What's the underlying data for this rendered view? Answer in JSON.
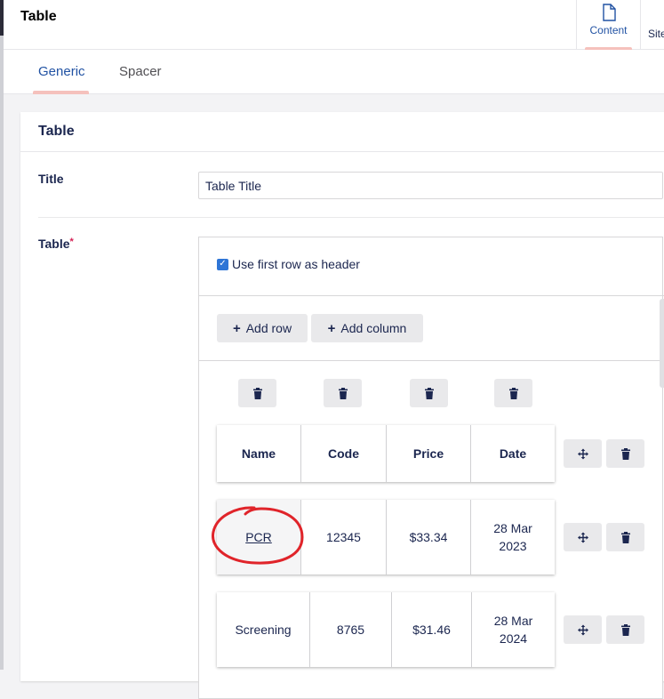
{
  "header": {
    "title": "Table"
  },
  "app_tabs": [
    {
      "label": "Content",
      "icon": "document-icon",
      "active": true
    },
    {
      "label": "Site"
    }
  ],
  "subtabs": [
    {
      "label": "Generic",
      "active": true
    },
    {
      "label": "Spacer",
      "active": false
    }
  ],
  "panel": {
    "title": "Table",
    "fields": {
      "title_label": "Title",
      "title_value": "Table Title",
      "table_label": "Table",
      "required_mark": "*"
    }
  },
  "table_editor": {
    "header_option": {
      "label": "Use first row as header",
      "checked": true
    },
    "add_row_label": "Add row",
    "add_column_label": "Add column",
    "rows": [
      {
        "cells": [
          "Name",
          "Code",
          "Price",
          "Date"
        ],
        "is_header": true
      },
      {
        "cells": [
          "PCR",
          "12345",
          "$33.34",
          "28 Mar 2023"
        ]
      },
      {
        "cells": [
          "Screening",
          "8765",
          "$31.46",
          "28 Mar 2024"
        ]
      }
    ]
  },
  "colors": {
    "accent": "#2152a3",
    "tab_underline": "#f5c1bc",
    "required": "#d42054",
    "annotation": "#e0242a"
  }
}
